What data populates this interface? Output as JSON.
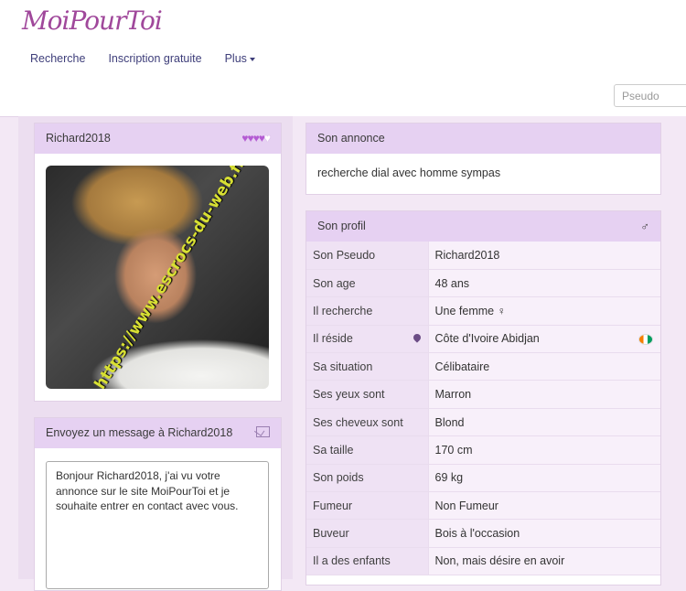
{
  "brand": {
    "logo": "MoiPourToi"
  },
  "nav": [
    {
      "label": "Recherche"
    },
    {
      "label": "Inscription gratuite"
    },
    {
      "label": "Plus"
    }
  ],
  "search": {
    "placeholder": "Pseudo"
  },
  "user_card": {
    "username": "Richard2018",
    "hearts_filled": 3.5,
    "hearts_total": 5,
    "watermark": "https://www.escrocs-du-web.fr"
  },
  "message": {
    "title": "Envoyez un message à Richard2018",
    "body": "Bonjour Richard2018, j'ai vu votre annonce sur le site MoiPourToi et je souhaite entrer en contact avec vous."
  },
  "annonce": {
    "title": "Son annonce",
    "text": "recherche dial avec homme sympas"
  },
  "profile": {
    "title": "Son profil",
    "gender_symbol": "♂",
    "rows": [
      {
        "label": "Son Pseudo",
        "value": "Richard2018"
      },
      {
        "label": "Son age",
        "value": "48 ans"
      },
      {
        "label": "Il recherche",
        "value": "Une femme ♀"
      },
      {
        "label": "Il réside",
        "value": "Côte d'Ivoire Abidjan"
      },
      {
        "label": "Sa situation",
        "value": "Célibataire"
      },
      {
        "label": "Ses yeux sont",
        "value": "Marron"
      },
      {
        "label": "Ses cheveux sont",
        "value": "Blond"
      },
      {
        "label": "Sa taille",
        "value": "170 cm"
      },
      {
        "label": "Son poids",
        "value": "69 kg"
      },
      {
        "label": "Fumeur",
        "value": "Non Fumeur"
      },
      {
        "label": "Buveur",
        "value": "Bois à l'occasion"
      },
      {
        "label": "Il a des enfants",
        "value": "Non, mais désire en avoir"
      }
    ]
  },
  "colors": {
    "accent": "#a0489b",
    "panel_head": "#e6d1f2",
    "nav_text": "#3e3e7a"
  }
}
